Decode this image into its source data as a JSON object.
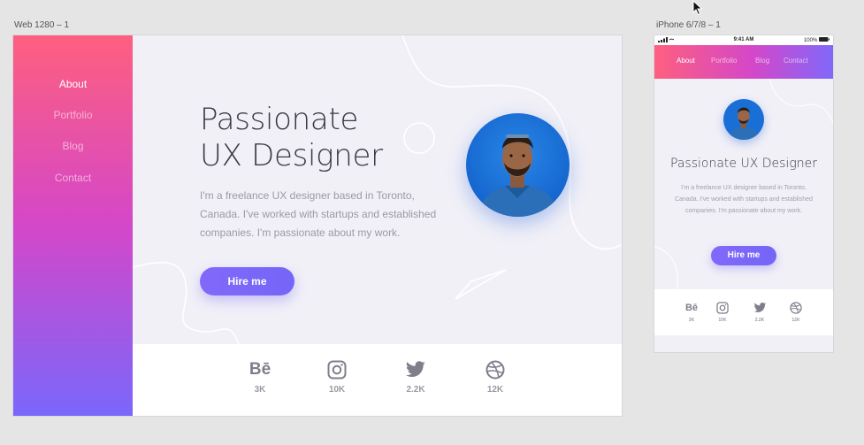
{
  "artboards": {
    "web_label": "Web 1280 – 1",
    "phone_label": "iPhone 6/7/8 – 1"
  },
  "web": {
    "nav": [
      "About",
      "Portfolio",
      "Blog",
      "Contact"
    ],
    "headline_line1": "Passionate",
    "headline_line2": "UX Designer",
    "bio": "I'm a freelance UX designer based in Toronto, Canada. I've worked with startups and established companies. I'm passionate about my work.",
    "cta": "Hire me",
    "social": [
      {
        "icon": "behance-icon",
        "glyph": "Bē",
        "count": "3K"
      },
      {
        "icon": "instagram-icon",
        "count": "10K"
      },
      {
        "icon": "twitter-icon",
        "count": "2.2K"
      },
      {
        "icon": "dribbble-icon",
        "count": "12K"
      }
    ]
  },
  "phone": {
    "status_time": "9:41 AM",
    "status_battery": "100%",
    "nav": [
      "About",
      "Portfolio",
      "Blog",
      "Contact"
    ],
    "title": "Passionate UX Designer",
    "bio": "I'm a freelance UX designer based in Toronto, Canada. I've worked with startups and established companies. I'm passionate about my work.",
    "cta": "Hire me",
    "social": [
      {
        "icon": "behance-icon",
        "glyph": "Bē",
        "count": "3K"
      },
      {
        "icon": "instagram-icon",
        "count": "10K"
      },
      {
        "icon": "twitter-icon",
        "count": "2.2K"
      },
      {
        "icon": "dribbble-icon",
        "count": "12K"
      }
    ]
  },
  "colors": {
    "gradient_top": "#fe5f7f",
    "gradient_mid": "#d447c9",
    "gradient_bottom": "#7a67fb",
    "button": "#7867f8",
    "canvas": "#e5e5e5"
  }
}
